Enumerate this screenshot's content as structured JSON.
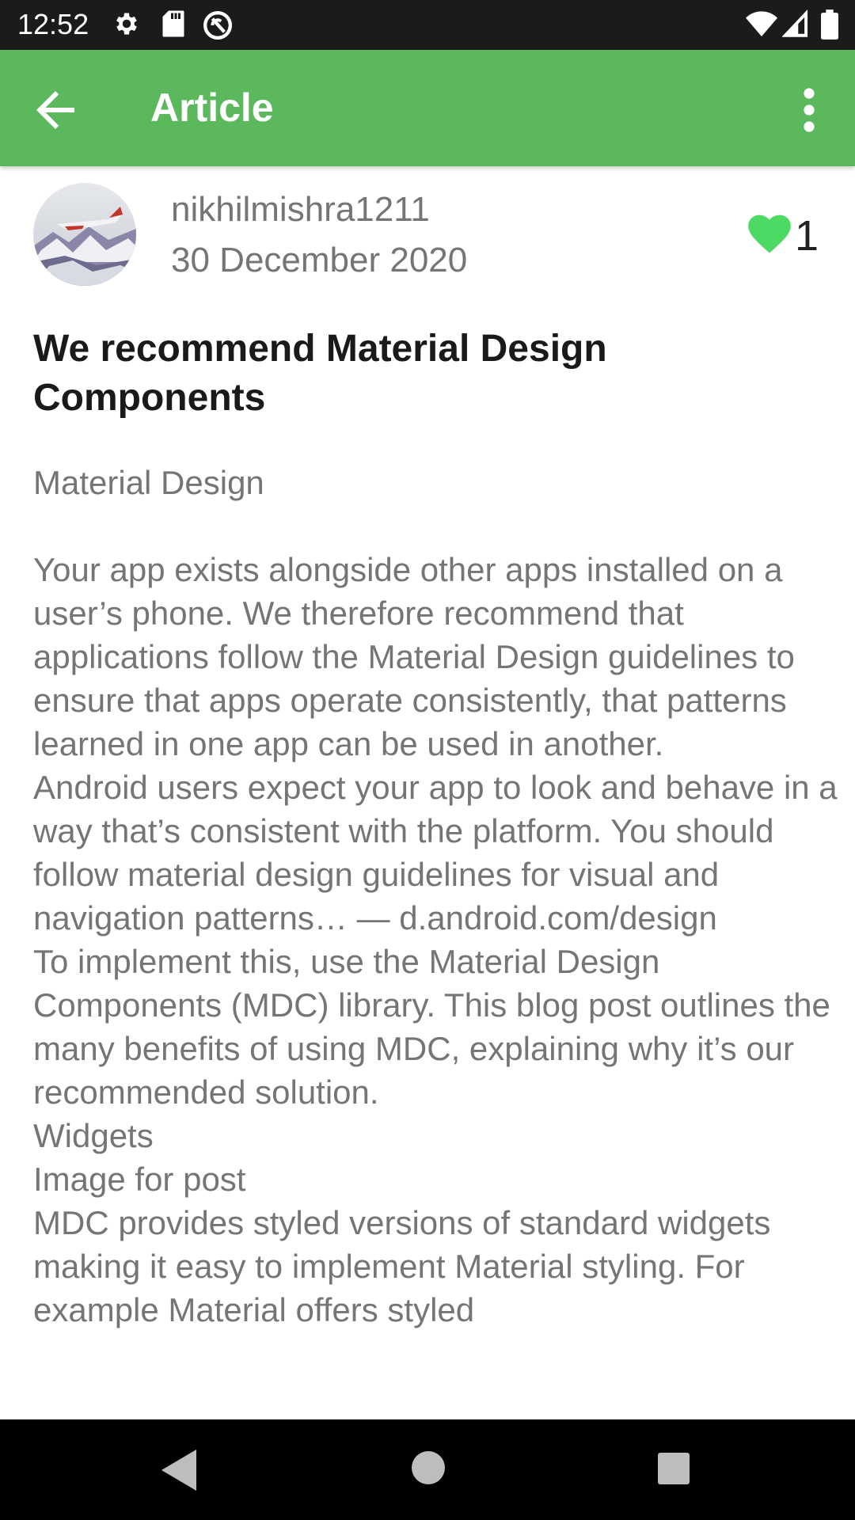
{
  "status_bar": {
    "time": "12:52",
    "icons_left": [
      "gear-icon",
      "sd-card-icon",
      "sync-blocked-icon"
    ],
    "icons_right": [
      "wifi-icon",
      "signal-icon",
      "battery-icon"
    ]
  },
  "app_bar": {
    "title": "Article",
    "back_icon": "arrow-left-icon",
    "menu_icon": "more-vert-icon",
    "color": "#5cb85c"
  },
  "post": {
    "author": "nikhilmishra1211",
    "date": "30 December 2020",
    "like_count": "1",
    "heart_color": "#4cd964",
    "title": "We recommend Material Design Components",
    "body": {
      "subtitle": "Material Design",
      "p1": "Your app exists alongside other apps installed on a user’s phone. We therefore recommend that applications follow the Material Design guidelines to ensure that apps operate consistently, that patterns learned in one app can be used in another.",
      "p2": "Android users expect your app to look and behave in a way that’s consistent with the platform. You should follow material design guidelines for visual and navigation patterns… — d.android.com/design",
      "p3": "To implement this, use the Material Design Components (MDC) library. This blog post outlines the many benefits of using MDC, explaining why it’s our recommended solution.",
      "p4": "Widgets",
      "p5": "Image for post",
      "p6": "MDC provides styled versions of standard widgets making it easy to implement Material styling. For example Material offers styled"
    }
  },
  "nav_bar": {
    "buttons": [
      "back-triangle-icon",
      "home-circle-icon",
      "recents-square-icon"
    ]
  }
}
